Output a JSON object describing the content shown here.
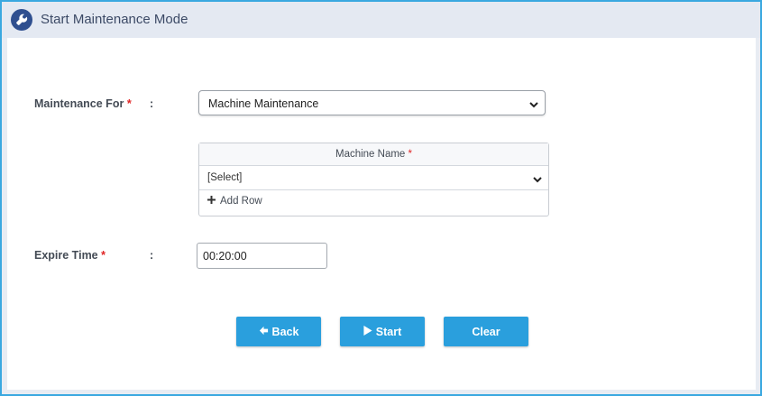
{
  "header": {
    "title": "Start Maintenance Mode",
    "icon": "wrench-icon"
  },
  "form": {
    "maintenance_for": {
      "label": "Maintenance For",
      "required_mark": "*",
      "colon": ":",
      "selected": "Machine Maintenance"
    },
    "machine_table": {
      "column_header": "Machine Name",
      "required_mark": "*",
      "rows": [
        {
          "value": "[Select]"
        }
      ],
      "add_row_label": "Add Row"
    },
    "expire_time": {
      "label": "Expire Time",
      "required_mark": "*",
      "colon": ":",
      "value": "00:20:00"
    }
  },
  "actions": {
    "back_label": "Back",
    "start_label": "Start",
    "clear_label": "Clear"
  },
  "colors": {
    "accent": "#2a9fdd",
    "header_icon_bg": "#2f4f8f",
    "required": "#e02424"
  }
}
